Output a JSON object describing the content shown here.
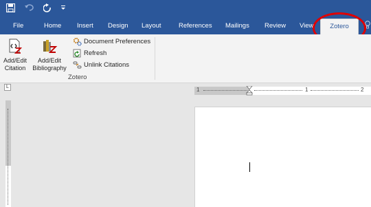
{
  "quick_access": {
    "save_icon": "save-icon",
    "undo_icon": "undo-icon",
    "redo_icon": "redo-icon",
    "customize_icon": "customize-qat-icon"
  },
  "tabs": [
    {
      "label": "File"
    },
    {
      "label": "Home"
    },
    {
      "label": "Insert"
    },
    {
      "label": "Design"
    },
    {
      "label": "Layout"
    },
    {
      "label": "References"
    },
    {
      "label": "Mailings"
    },
    {
      "label": "Review"
    },
    {
      "label": "View"
    },
    {
      "label": "Zotero",
      "active": true
    }
  ],
  "ribbon": {
    "add_edit_citation": {
      "line1": "Add/Edit",
      "line2": "Citation"
    },
    "add_edit_bibliography": {
      "line1": "Add/Edit",
      "line2": "Bibliography"
    },
    "document_preferences": "Document Preferences",
    "refresh": "Refresh",
    "unlink_citations": "Unlink Citations",
    "group_label": "Zotero"
  },
  "ruler": {
    "tab_selector": "L",
    "left_mark": "1",
    "mid_mark": "1",
    "right_mark": "2"
  },
  "colors": {
    "ribbon_blue": "#2b579a",
    "highlight_circle": "#e00000"
  }
}
